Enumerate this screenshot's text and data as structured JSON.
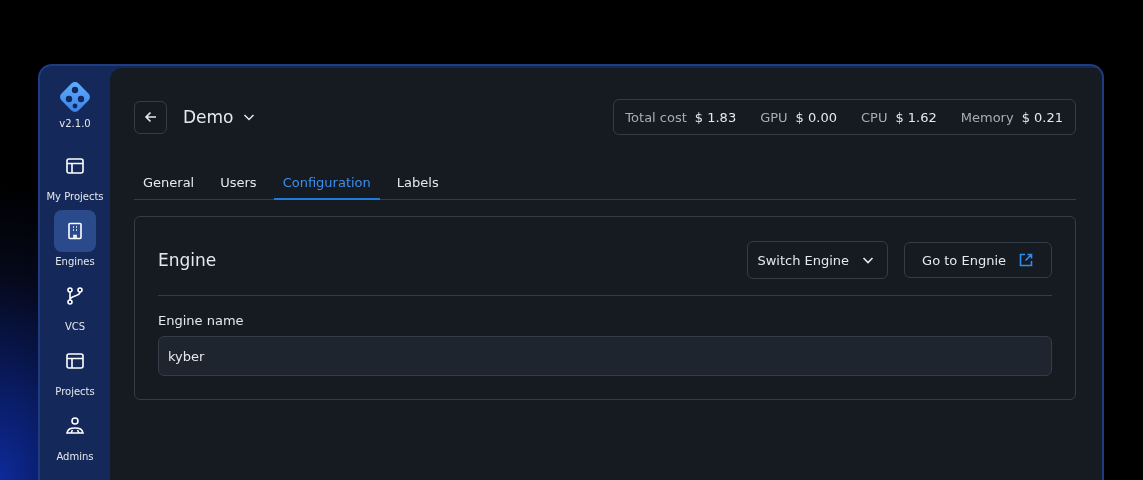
{
  "sidebar": {
    "version": "v2.1.0",
    "items": [
      {
        "label": "My Projects",
        "kind": "layout",
        "selected": false
      },
      {
        "label": "Engines",
        "kind": "building",
        "selected": true
      },
      {
        "label": "VCS",
        "kind": "branch",
        "selected": false
      },
      {
        "label": "Projects",
        "kind": "layout",
        "selected": false
      },
      {
        "label": "Admins",
        "kind": "people",
        "selected": false
      }
    ]
  },
  "header": {
    "project": "Demo",
    "costs": [
      {
        "label": "Total cost",
        "value": "$ 1.83"
      },
      {
        "label": "GPU",
        "value": "$ 0.00"
      },
      {
        "label": "CPU",
        "value": "$ 1.62"
      },
      {
        "label": "Memory",
        "value": "$ 0.21"
      }
    ]
  },
  "tabs": [
    {
      "label": "General",
      "selected": false
    },
    {
      "label": "Users",
      "selected": false
    },
    {
      "label": "Configuration",
      "selected": true
    },
    {
      "label": "Labels",
      "selected": false
    }
  ],
  "card": {
    "title": "Engine",
    "switch_button": "Switch Engine",
    "go_button": "Go to Engnie",
    "field_label": "Engine name",
    "field_value": "kyber"
  }
}
